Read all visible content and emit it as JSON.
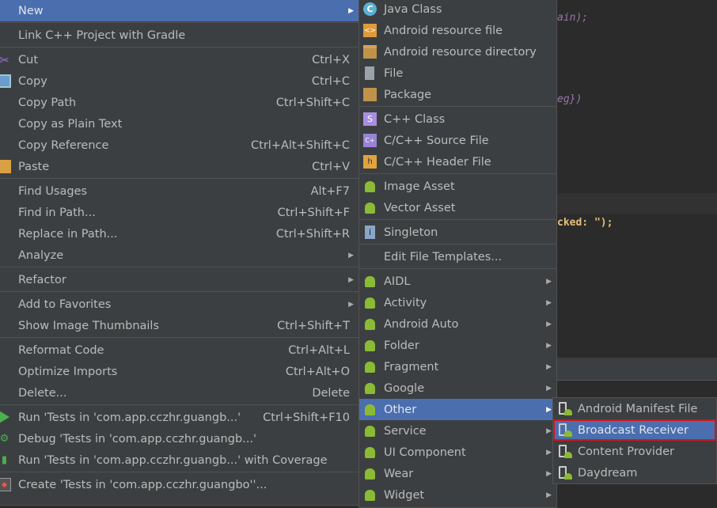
{
  "colors": {
    "menu_bg": "#3c3f41",
    "highlight": "#4b6eaf",
    "text": "#bbbbbb",
    "selection_border": "#d0161b",
    "editor_bg": "#2b2b2b"
  },
  "editor": {
    "code_lines": [
      "ain);",
      "eg})",
      "cked: \");"
    ]
  },
  "main_menu": [
    {
      "label": "New",
      "arrow": true,
      "highlighted": true
    },
    {
      "sep": true
    },
    {
      "label": "Link C++ Project with Gradle"
    },
    {
      "sep": true
    },
    {
      "label": "Cut",
      "shortcut": "Ctrl+X",
      "icon": "scissors-icon"
    },
    {
      "label": "Copy",
      "shortcut": "Ctrl+C",
      "icon": "copy-icon"
    },
    {
      "label": "Copy Path",
      "shortcut": "Ctrl+Shift+C"
    },
    {
      "label": "Copy as Plain Text"
    },
    {
      "label": "Copy Reference",
      "shortcut": "Ctrl+Alt+Shift+C"
    },
    {
      "label": "Paste",
      "shortcut": "Ctrl+V",
      "icon": "paste-icon"
    },
    {
      "sep": true
    },
    {
      "label": "Find Usages",
      "shortcut": "Alt+F7"
    },
    {
      "label": "Find in Path...",
      "shortcut": "Ctrl+Shift+F"
    },
    {
      "label": "Replace in Path...",
      "shortcut": "Ctrl+Shift+R"
    },
    {
      "label": "Analyze",
      "arrow": true
    },
    {
      "sep": true
    },
    {
      "label": "Refactor",
      "arrow": true
    },
    {
      "sep": true
    },
    {
      "label": "Add to Favorites",
      "arrow": true
    },
    {
      "label": "Show Image Thumbnails",
      "shortcut": "Ctrl+Shift+T"
    },
    {
      "sep": true
    },
    {
      "label": "Reformat Code",
      "shortcut": "Ctrl+Alt+L"
    },
    {
      "label": "Optimize Imports",
      "shortcut": "Ctrl+Alt+O"
    },
    {
      "label": "Delete...",
      "shortcut": "Delete"
    },
    {
      "sep": true
    },
    {
      "label": "Run 'Tests in 'com.app.cczhr.guangb...'",
      "shortcut": "Ctrl+Shift+F10",
      "icon": "run-icon"
    },
    {
      "label": "Debug 'Tests in 'com.app.cczhr.guangb...'",
      "icon": "debug-icon"
    },
    {
      "label": "Run 'Tests in 'com.app.cczhr.guangb...' with Coverage",
      "icon": "coverage-icon"
    },
    {
      "sep": true
    },
    {
      "label": "Create 'Tests in 'com.app.cczhr.guangbo''...",
      "icon": "create-test-icon"
    }
  ],
  "new_menu": [
    {
      "label": "Java Class",
      "icon": "java-class-icon"
    },
    {
      "label": "Android resource file",
      "icon": "resource-file-icon"
    },
    {
      "label": "Android resource directory",
      "icon": "folder-icon"
    },
    {
      "label": "File",
      "icon": "file-icon"
    },
    {
      "label": "Package",
      "icon": "package-icon"
    },
    {
      "sep": true
    },
    {
      "label": "C++ Class",
      "icon": "cpp-class-icon"
    },
    {
      "label": "C/C++ Source File",
      "icon": "cpp-source-icon"
    },
    {
      "label": "C/C++ Header File",
      "icon": "cpp-header-icon"
    },
    {
      "sep": true
    },
    {
      "label": "Image Asset",
      "icon": "android-icon"
    },
    {
      "label": "Vector Asset",
      "icon": "android-icon"
    },
    {
      "sep": true
    },
    {
      "label": "Singleton",
      "icon": "singleton-icon"
    },
    {
      "sep": true
    },
    {
      "label": "Edit File Templates..."
    },
    {
      "sep": true
    },
    {
      "label": "AIDL",
      "icon": "android-icon",
      "arrow": true
    },
    {
      "label": "Activity",
      "icon": "android-icon",
      "arrow": true
    },
    {
      "label": "Android Auto",
      "icon": "android-icon",
      "arrow": true
    },
    {
      "label": "Folder",
      "icon": "android-icon",
      "arrow": true
    },
    {
      "label": "Fragment",
      "icon": "android-icon",
      "arrow": true
    },
    {
      "label": "Google",
      "icon": "android-icon",
      "arrow": true
    },
    {
      "label": "Other",
      "icon": "android-icon",
      "arrow": true,
      "highlighted": true
    },
    {
      "label": "Service",
      "icon": "android-icon",
      "arrow": true
    },
    {
      "label": "UI Component",
      "icon": "android-icon",
      "arrow": true
    },
    {
      "label": "Wear",
      "icon": "android-icon",
      "arrow": true
    },
    {
      "label": "Widget",
      "icon": "android-icon",
      "arrow": true
    }
  ],
  "other_menu": [
    {
      "label": "Android Manifest File",
      "icon": "android-file-icon"
    },
    {
      "label": "Broadcast Receiver",
      "icon": "android-file-icon",
      "highlighted": true,
      "selected": true
    },
    {
      "label": "Content Provider",
      "icon": "android-file-icon"
    },
    {
      "label": "Daydream",
      "icon": "android-file-icon"
    }
  ]
}
